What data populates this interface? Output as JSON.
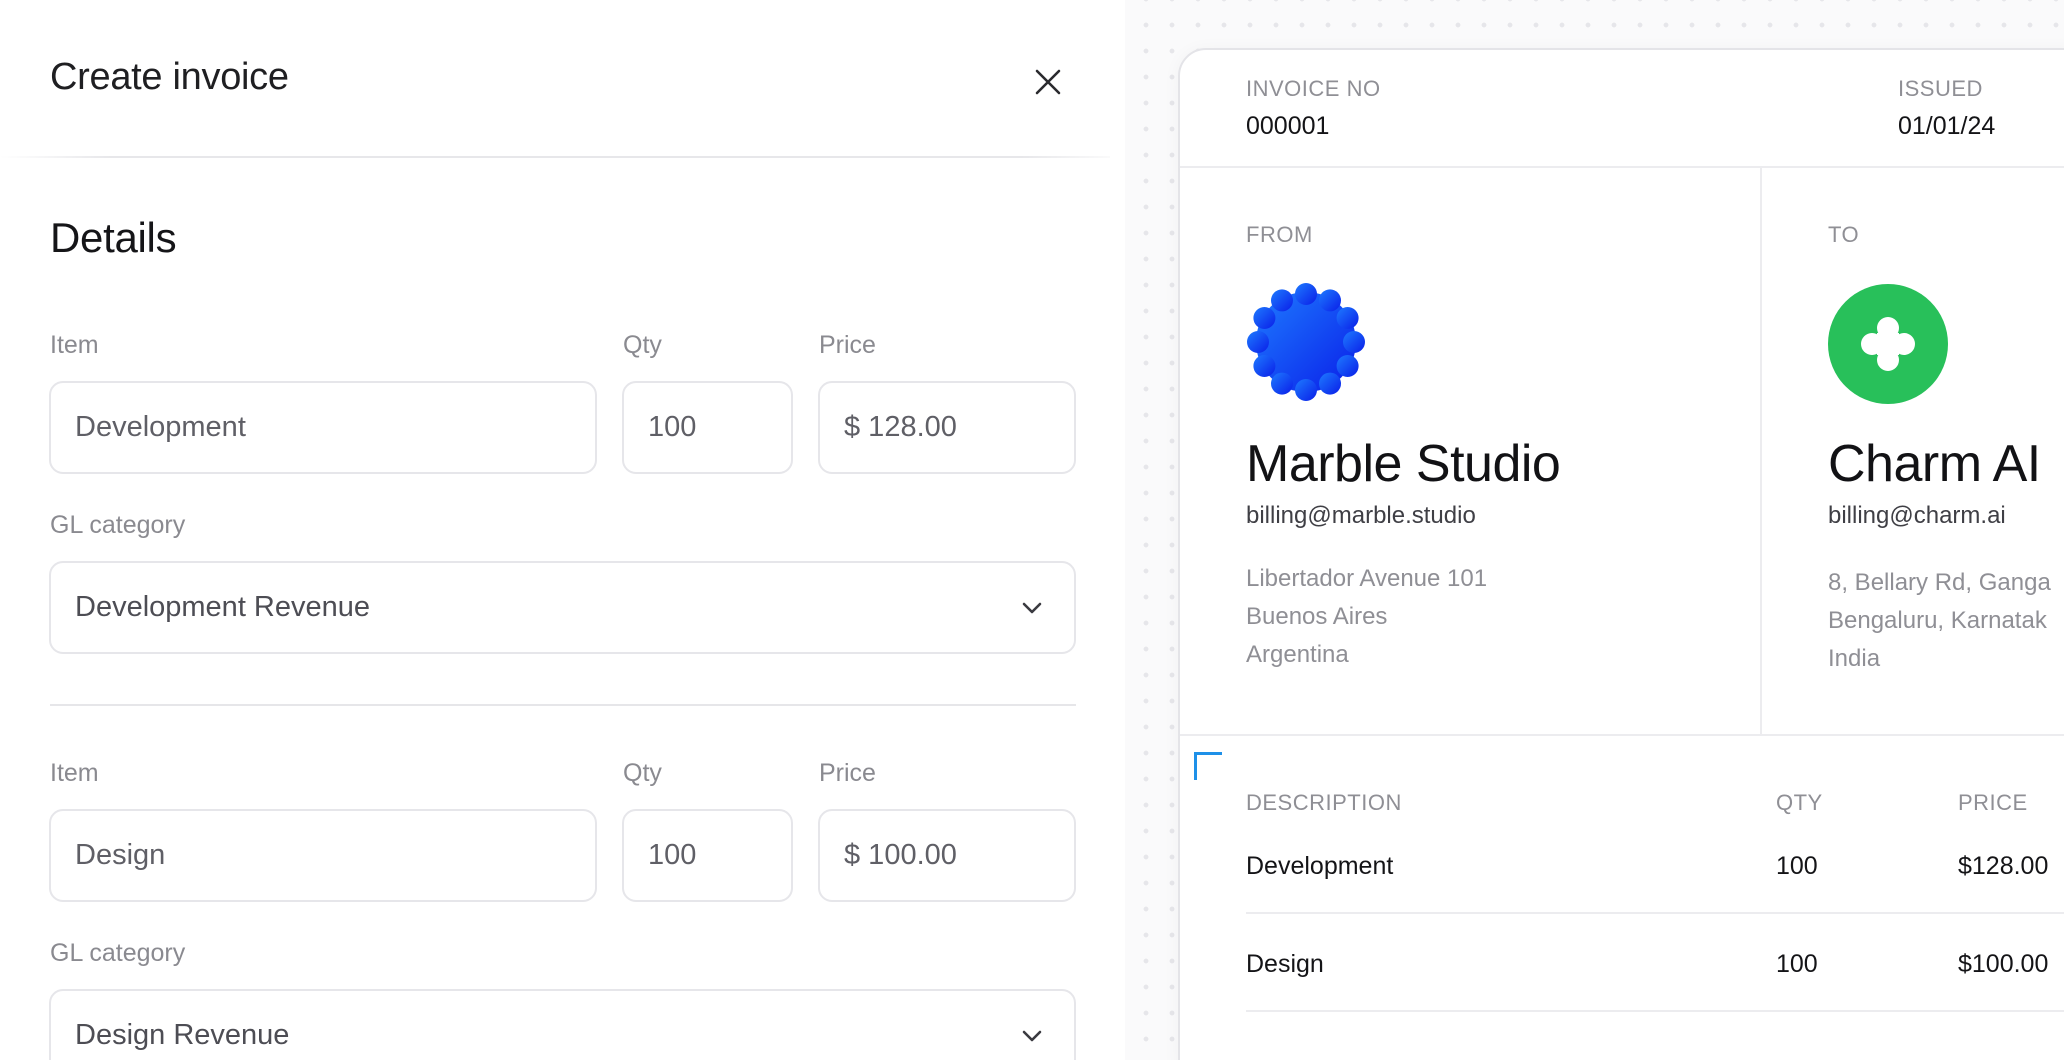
{
  "form": {
    "title": "Create invoice",
    "section_title": "Details",
    "labels": {
      "item": "Item",
      "qty": "Qty",
      "price": "Price",
      "gl_category": "GL category"
    },
    "line_items": [
      {
        "item": "Development",
        "qty": "100",
        "price": "$ 128.00",
        "gl_category": "Development Revenue"
      },
      {
        "item": "Design",
        "qty": "100",
        "price": "$ 100.00",
        "gl_category": "Design Revenue"
      }
    ]
  },
  "invoice": {
    "number_label": "INVOICE NO",
    "number": "000001",
    "issued_label": "ISSUED",
    "issued": "01/01/24",
    "from": {
      "label": "FROM",
      "name": "Marble Studio",
      "email": "billing@marble.studio",
      "address": [
        "Libertador Avenue 101",
        "Buenos Aires",
        "Argentina"
      ],
      "logo_color": "#0a3cff"
    },
    "to": {
      "label": "TO",
      "name": "Charm AI",
      "email": "billing@charm.ai",
      "address": [
        "8, Bellary Rd, Ganga",
        "Bengaluru, Karnatak",
        "India"
      ],
      "logo_color": "#28c05a"
    },
    "columns": {
      "description": "DESCRIPTION",
      "qty": "QTY",
      "price": "PRICE"
    },
    "lines": [
      {
        "description": "Development",
        "qty": "100",
        "price": "$128.00"
      },
      {
        "description": "Design",
        "qty": "100",
        "price": "$100.00"
      }
    ]
  },
  "icons": {
    "close": "close-icon",
    "chevron": "chevron-down-icon",
    "marble_logo": "marble-logo-icon",
    "charm_logo": "charm-logo-icon"
  }
}
